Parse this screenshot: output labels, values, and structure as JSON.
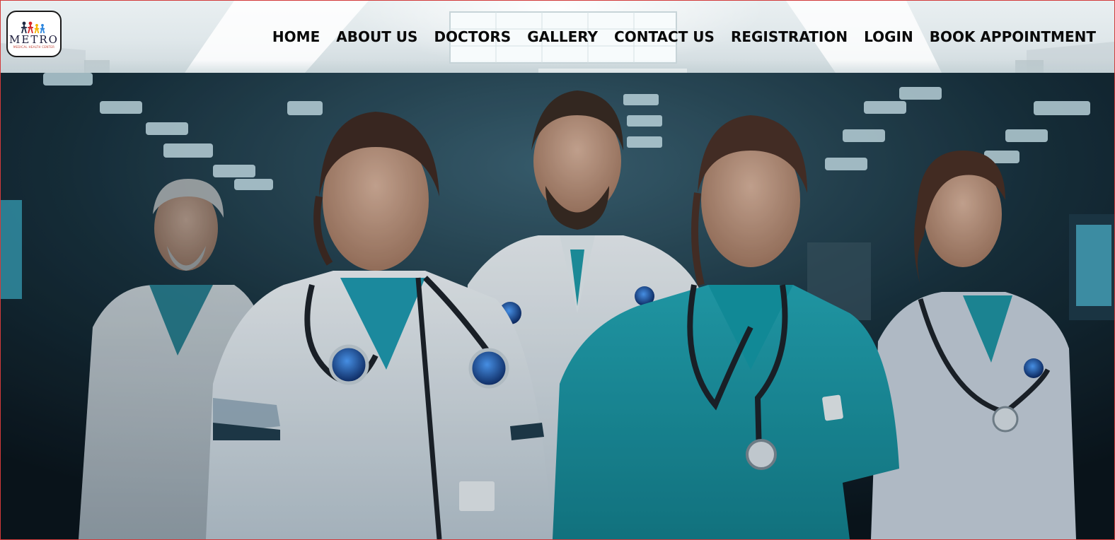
{
  "site": {
    "logo": {
      "name": "METRO",
      "tagline": "MEDICAL HEALTH CENTER",
      "figure_colors": [
        "#1f2a44",
        "#d62828",
        "#f4b400",
        "#2e86de"
      ]
    }
  },
  "nav": {
    "items": [
      {
        "id": "home",
        "label": "HOME"
      },
      {
        "id": "about",
        "label": "ABOUT US"
      },
      {
        "id": "doctors",
        "label": "DOCTORS"
      },
      {
        "id": "gallery",
        "label": "GALLERY"
      },
      {
        "id": "contact",
        "label": "CONTACT US"
      },
      {
        "id": "registration",
        "label": "REGISTRATION"
      },
      {
        "id": "login",
        "label": "LOGIN"
      },
      {
        "id": "book",
        "label": "BOOK APPOINTMENT"
      }
    ]
  },
  "hero": {
    "image_subject": "medical-team-photo",
    "colors": {
      "background": "#0f1c25",
      "scrubs_teal": "#1b97a6",
      "coat_white": "#dfe6ec",
      "ceiling_light": "#cfeaf2"
    }
  }
}
